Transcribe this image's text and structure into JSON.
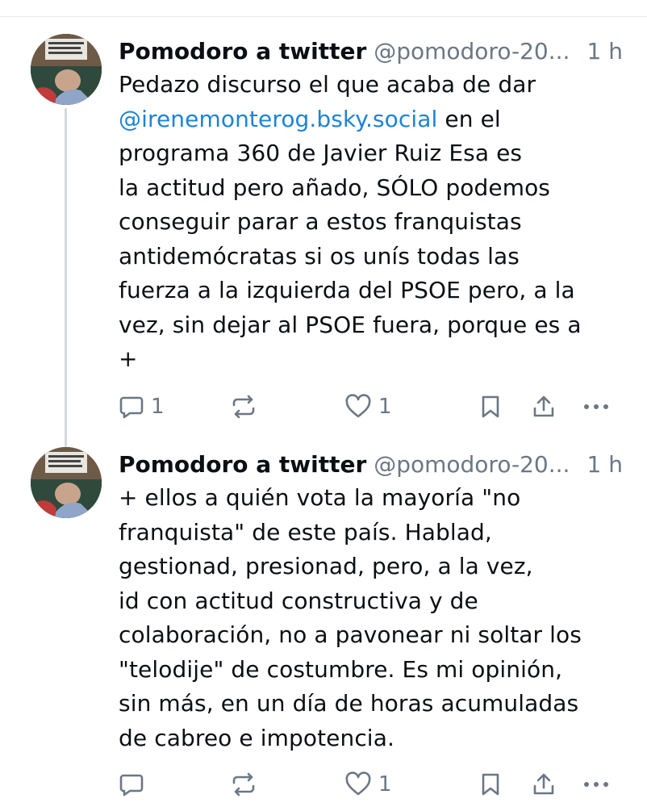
{
  "posts": [
    {
      "author": "Pomodoro a twitter",
      "handle": "@pomodoro-20...",
      "time": "1 h",
      "body_lines": [
        {
          "mention": "",
          "text": "Pedazo discurso el que acaba de dar"
        },
        {
          "mention": "@irenemonterog.bsky.social",
          "text": " en el"
        },
        {
          "mention": "",
          "text": "programa 360 de Javier Ruiz Esa es"
        },
        {
          "mention": "",
          "text": "la actitud pero añado, SÓLO podemos"
        },
        {
          "mention": "",
          "text": "conseguir parar a estos franquistas"
        },
        {
          "mention": "",
          "text": "antidemócratas si os unís todas las"
        },
        {
          "mention": "",
          "text": "fuerza a la izquierda del PSOE pero, a la"
        },
        {
          "mention": "",
          "text": "vez, sin dejar al PSOE fuera, porque es a"
        },
        {
          "mention": "",
          "text": "+"
        }
      ],
      "reply_count": "1",
      "like_count": "1"
    },
    {
      "author": "Pomodoro a twitter",
      "handle": "@pomodoro-20...",
      "time": "1 h",
      "body_lines": [
        {
          "mention": "",
          "text": "+ ellos a quién vota la mayoría \"no"
        },
        {
          "mention": "",
          "text": "franquista\" de este país. Hablad,"
        },
        {
          "mention": "",
          "text": "gestionad, presionad, pero, a la vez,"
        },
        {
          "mention": "",
          "text": "id con actitud constructiva y de"
        },
        {
          "mention": "",
          "text": "colaboración, no a pavonear ni soltar los"
        },
        {
          "mention": "",
          "text": "\"telodije\" de costumbre. Es mi opinión,"
        },
        {
          "mention": "",
          "text": "sin más, en un día de horas acumuladas"
        },
        {
          "mention": "",
          "text": "de cabreo e impotencia."
        }
      ],
      "reply_count": "",
      "like_count": "1"
    }
  ],
  "icons": {
    "reply": "reply-icon",
    "repost": "repost-icon",
    "like": "heart-icon",
    "bookmark": "bookmark-icon",
    "share": "share-icon",
    "more": "more-icon"
  },
  "colors": {
    "text": "#0b0f14",
    "muted": "#6b7784",
    "mention": "#1d83d6",
    "thread_line": "#d4d9de"
  }
}
